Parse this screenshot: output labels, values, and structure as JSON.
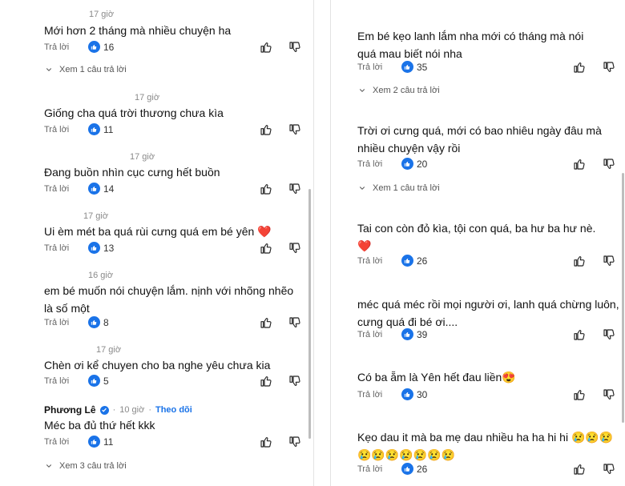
{
  "left": {
    "comments": [
      {
        "time": "17 giờ",
        "text": "Mới hơn 2 tháng mà nhiều chuyện ha",
        "reply": "Trả lời",
        "likes": "16"
      },
      {
        "time": "17 giờ",
        "text": "Giống cha quá trời thương chưa kìa",
        "reply": "Trả lời",
        "likes": "11"
      },
      {
        "time": "17 giờ",
        "text": "Đang buồn nhìn cục cưng hết buồn",
        "reply": "Trả lời",
        "likes": "14"
      },
      {
        "time": "17 giờ",
        "text": "Ui èm mét ba quá rùi cưng quá em bé yên ❤️",
        "reply": "Trả lời",
        "likes": "13"
      },
      {
        "time": "16 giờ",
        "text": "em bé muốn nói chuyện lắm. nịnh với nhõng nhẽo là số một",
        "reply": "Trả lời",
        "likes": "8"
      },
      {
        "time": "17 giờ",
        "text": "Chèn ơi kể chuyen cho ba nghe yêu chưa kia",
        "reply": "Trả lời",
        "likes": "5"
      },
      {
        "author": "Phương Lê",
        "time": "10 giờ",
        "follow": "Theo dõi",
        "text": "Méc ba đủ thứ hết kkk",
        "reply": "Trả lời",
        "likes": "11"
      }
    ],
    "view_replies": [
      "Xem 1 câu trả lời",
      "Xem 3 câu trả lời"
    ]
  },
  "right": {
    "comments": [
      {
        "text": "Em bé kẹo lanh lắm nha  mới có tháng mà nói quá mau biết nói nha",
        "reply": "Trả lời",
        "likes": "35"
      },
      {
        "text": "Trời ơi cưng quá, mới có bao nhiêu ngày đâu mà nhiều chuyện vậy rồi",
        "reply": "Trả lời",
        "likes": "20"
      },
      {
        "text": "Tai con còn đỏ kìa, tội con quá, ba hư ba hư nè. ❤️",
        "reply": "Trả lời",
        "likes": "26"
      },
      {
        "text": "méc quá méc rồi  mọi người ơi, lanh quá chừng luôn, cưng quá đi bé ơi....",
        "reply": "Trả lời",
        "likes": "39"
      },
      {
        "text": "Có ba ẵm là Yên hết đau liền😍",
        "reply": "Trả lời",
        "likes": "30"
      },
      {
        "text": "Kẹo dau it mà ba mẹ dau nhiều ha ha hi hi 😢😢😢 😢😢😢😢😢😢😢",
        "reply": "Trả lời",
        "likes": "26"
      }
    ],
    "view_replies": [
      "Xem 2 câu trả lời",
      "Xem 1 câu trả lời"
    ]
  },
  "icons": {
    "like_badge": "thumbs-up-badge-icon",
    "like": "thumbs-up-outline-icon",
    "dislike": "thumbs-down-outline-icon",
    "expand": "chevron-down-icon",
    "verified": "verified-check-icon"
  },
  "colors": {
    "accent": "#1a73e8",
    "meta": "#8a8a8a"
  }
}
